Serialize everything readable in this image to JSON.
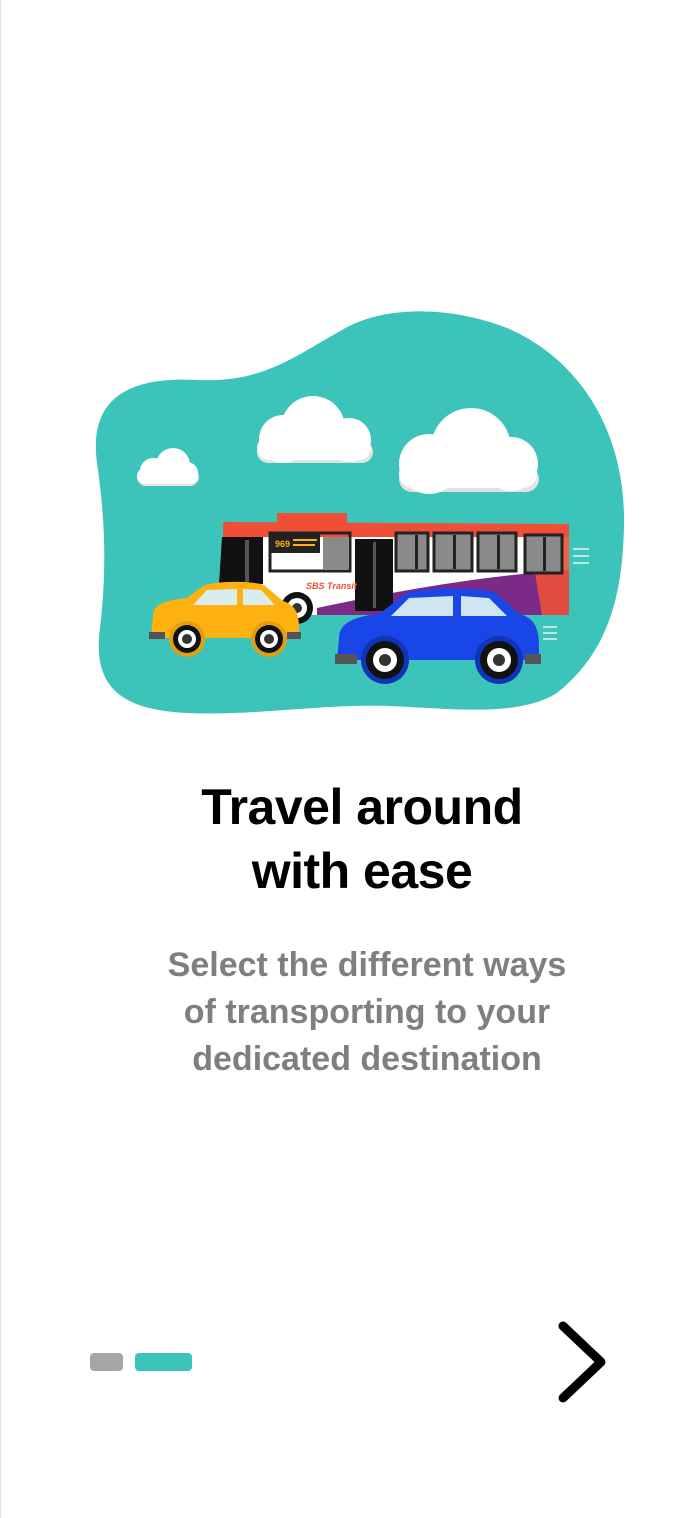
{
  "onboarding": {
    "heading": {
      "line1": "Travel around",
      "line2": "with ease"
    },
    "description": {
      "line1": "Select the different ways",
      "line2": "of transporting to your",
      "line3": "dedicated destination"
    },
    "illustration": {
      "bus": {
        "route_number": "969",
        "operator_logo": "SBS Transit"
      }
    },
    "pager": {
      "total_pages": 2,
      "current_page": 2
    },
    "next_icon": "chevron-right-icon"
  },
  "colors": {
    "accent": "#3cc4bb",
    "inactive_dot": "#a6a6a6",
    "heading": "#000000",
    "body_text": "#7f7f7f",
    "bus_red": "#ee4f36",
    "bus_purple": "#7b2a88",
    "car_yellow": "#ffb10f",
    "car_blue": "#1946e6"
  }
}
